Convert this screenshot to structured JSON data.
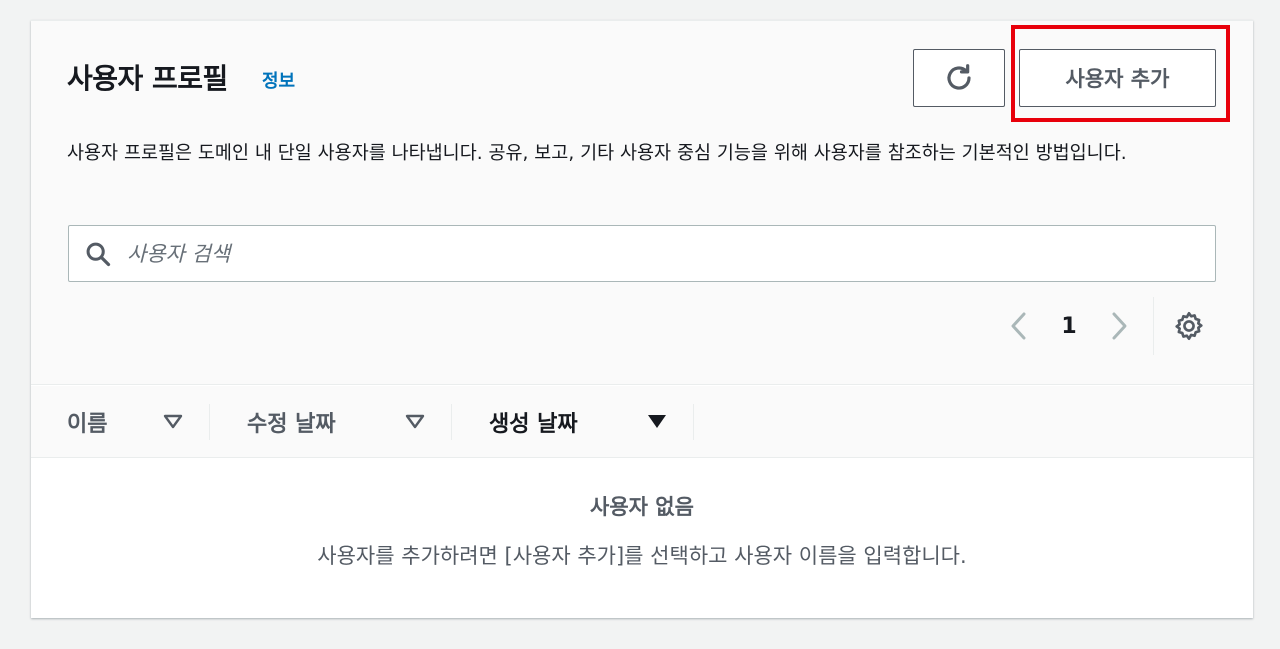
{
  "header": {
    "title": "사용자 프로필",
    "info_link": "정보",
    "add_button": "사용자 추가"
  },
  "description": "사용자 프로필은 도메인 내 단일 사용자를 나타냅니다. 공유, 보고, 기타 사용자 중심 기능을 위해 사용자를 참조하는 기본적인 방법입니다.",
  "search": {
    "placeholder": "사용자 검색",
    "value": ""
  },
  "pagination": {
    "current_page": "1"
  },
  "table": {
    "columns": [
      {
        "label": "이름",
        "sort": "none"
      },
      {
        "label": "수정 날짜",
        "sort": "none"
      },
      {
        "label": "생성 날짜",
        "sort": "descending"
      }
    ]
  },
  "empty_state": {
    "title": "사용자 없음",
    "message": "사용자를 추가하려면 [사용자 추가]를 선택하고 사용자 이름을 입력합니다."
  },
  "colors": {
    "link": "#0073bb",
    "highlight": "#e8000b",
    "text_primary": "#16191f",
    "text_secondary": "#545b64"
  }
}
